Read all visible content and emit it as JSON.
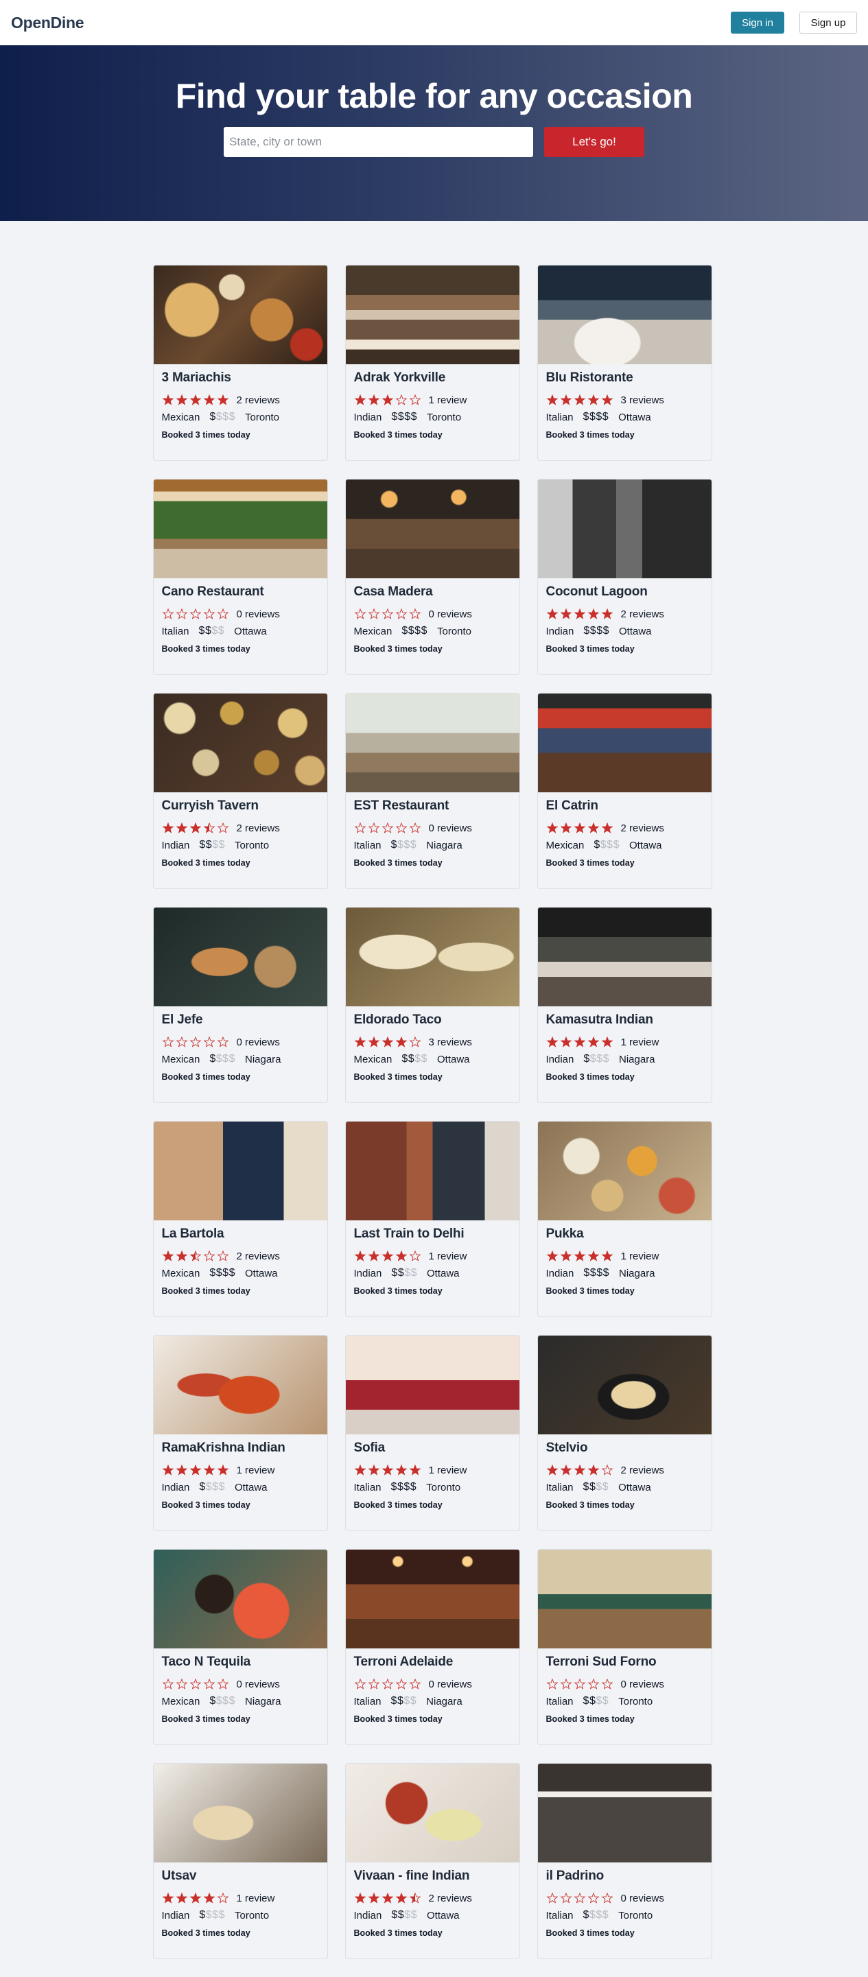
{
  "nav": {
    "logo": "OpenDine",
    "signin_label": "Sign in",
    "signup_label": "Sign up"
  },
  "hero": {
    "title": "Find your table for any occasion",
    "search_placeholder": "State, city or town",
    "search_button": "Let's go!"
  },
  "colors": {
    "nav_signin": "#21809d",
    "search_button": "#c9252c",
    "star": "#c9302c",
    "hero_start": "#0f1f4b",
    "hero_end": "#5b6582"
  },
  "restaurants": [
    {
      "name": "3 Mariachis",
      "rating": 5,
      "reviews": "2 reviews",
      "cuisine": "Mexican",
      "price_level": 1,
      "city": "Toronto",
      "booked": "Booked 3 times today",
      "image": "mexican-food-spread"
    },
    {
      "name": "Adrak Yorkville",
      "rating": 3,
      "reviews": "1 review",
      "cuisine": "Indian",
      "price_level": 4,
      "city": "Toronto",
      "booked": "Booked 3 times today",
      "image": "lounge-interior"
    },
    {
      "name": "Blu Ristorante",
      "rating": 5,
      "reviews": "3 reviews",
      "cuisine": "Italian",
      "price_level": 4,
      "city": "Ottawa",
      "booked": "Booked 3 times today",
      "image": "plated-dish-bar"
    },
    {
      "name": "Cano Restaurant",
      "rating": 0,
      "reviews": "0 reviews",
      "cuisine": "Italian",
      "price_level": 2,
      "city": "Ottawa",
      "booked": "Booked 3 times today",
      "image": "patio-dining"
    },
    {
      "name": "Casa Madera",
      "rating": 0,
      "reviews": "0 reviews",
      "cuisine": "Mexican",
      "price_level": 4,
      "city": "Toronto",
      "booked": "Booked 3 times today",
      "image": "dining-room"
    },
    {
      "name": "Coconut Lagoon",
      "rating": 5,
      "reviews": "2 reviews",
      "cuisine": "Indian",
      "price_level": 4,
      "city": "Ottawa",
      "booked": "Booked 3 times today",
      "image": "modern-interior"
    },
    {
      "name": "Curryish Tavern",
      "rating": 3.5,
      "reviews": "2 reviews",
      "cuisine": "Indian",
      "price_level": 2,
      "city": "Toronto",
      "booked": "Booked 3 times today",
      "image": "plates-overhead"
    },
    {
      "name": "EST Restaurant",
      "rating": 0,
      "reviews": "0 reviews",
      "cuisine": "Italian",
      "price_level": 1,
      "city": "Niagara",
      "booked": "Booked 3 times today",
      "image": "bright-dining"
    },
    {
      "name": "El Catrin",
      "rating": 5,
      "reviews": "2 reviews",
      "cuisine": "Mexican",
      "price_level": 1,
      "city": "Ottawa",
      "booked": "Booked 3 times today",
      "image": "mural-patio"
    },
    {
      "name": "El Jefe",
      "rating": 0,
      "reviews": "0 reviews",
      "cuisine": "Mexican",
      "price_level": 1,
      "city": "Niagara",
      "booked": "Booked 3 times today",
      "image": "plated-food-dark"
    },
    {
      "name": "Eldorado Taco",
      "rating": 4,
      "reviews": "3 reviews",
      "cuisine": "Mexican",
      "price_level": 2,
      "city": "Ottawa",
      "booked": "Booked 3 times today",
      "image": "tacos"
    },
    {
      "name": "Kamasutra Indian",
      "rating": 5,
      "reviews": "1 review",
      "cuisine": "Indian",
      "price_level": 1,
      "city": "Niagara",
      "booked": "Booked 3 times today",
      "image": "dark-dining-room"
    },
    {
      "name": "La Bartola",
      "rating": 2.5,
      "reviews": "2 reviews",
      "cuisine": "Mexican",
      "price_level": 4,
      "city": "Ottawa",
      "booked": "Booked 3 times today",
      "image": "navy-interior"
    },
    {
      "name": "Last Train to Delhi",
      "rating": 4,
      "reviews": "1 review",
      "cuisine": "Indian",
      "price_level": 2,
      "city": "Ottawa",
      "booked": "Booked 3 times today",
      "image": "brick-wall-dining"
    },
    {
      "name": "Pukka",
      "rating": 5,
      "reviews": "1 review",
      "cuisine": "Indian",
      "price_level": 4,
      "city": "Niagara",
      "booked": "Booked 3 times today",
      "image": "indian-dishes"
    },
    {
      "name": "RamaKrishna Indian",
      "rating": 5,
      "reviews": "1 review",
      "cuisine": "Indian",
      "price_level": 1,
      "city": "Ottawa",
      "booked": "Booked 3 times today",
      "image": "curry-bowls"
    },
    {
      "name": "Sofia",
      "rating": 5,
      "reviews": "1 review",
      "cuisine": "Italian",
      "price_level": 4,
      "city": "Toronto",
      "booked": "Booked 3 times today",
      "image": "red-chairs"
    },
    {
      "name": "Stelvio",
      "rating": 4,
      "reviews": "2 reviews",
      "cuisine": "Italian",
      "price_level": 2,
      "city": "Ottawa",
      "booked": "Booked 3 times today",
      "image": "pasta-dark"
    },
    {
      "name": "Taco N Tequila",
      "rating": 0,
      "reviews": "0 reviews",
      "cuisine": "Mexican",
      "price_level": 1,
      "city": "Niagara",
      "booked": "Booked 3 times today",
      "image": "sugar-skull"
    },
    {
      "name": "Terroni Adelaide",
      "rating": 0,
      "reviews": "0 reviews",
      "cuisine": "Italian",
      "price_level": 2,
      "city": "Niagara",
      "booked": "Booked 3 times today",
      "image": "warm-interior"
    },
    {
      "name": "Terroni Sud Forno",
      "rating": 0,
      "reviews": "0 reviews",
      "cuisine": "Italian",
      "price_level": 2,
      "city": "Toronto",
      "booked": "Booked 3 times today",
      "image": "bakery-cafe"
    },
    {
      "name": "Utsav",
      "rating": 4,
      "reviews": "1 review",
      "cuisine": "Indian",
      "price_level": 1,
      "city": "Toronto",
      "booked": "Booked 3 times today",
      "image": "wine-plate"
    },
    {
      "name": "Vivaan - fine Indian",
      "rating": 4.5,
      "reviews": "2 reviews",
      "cuisine": "Indian",
      "price_level": 2,
      "city": "Ottawa",
      "booked": "Booked 3 times today",
      "image": "lobster-dish"
    },
    {
      "name": "il Padrino",
      "rating": 0,
      "reviews": "0 reviews",
      "cuisine": "Italian",
      "price_level": 1,
      "city": "Toronto",
      "booked": "Booked 3 times today",
      "image": "storefront"
    }
  ]
}
